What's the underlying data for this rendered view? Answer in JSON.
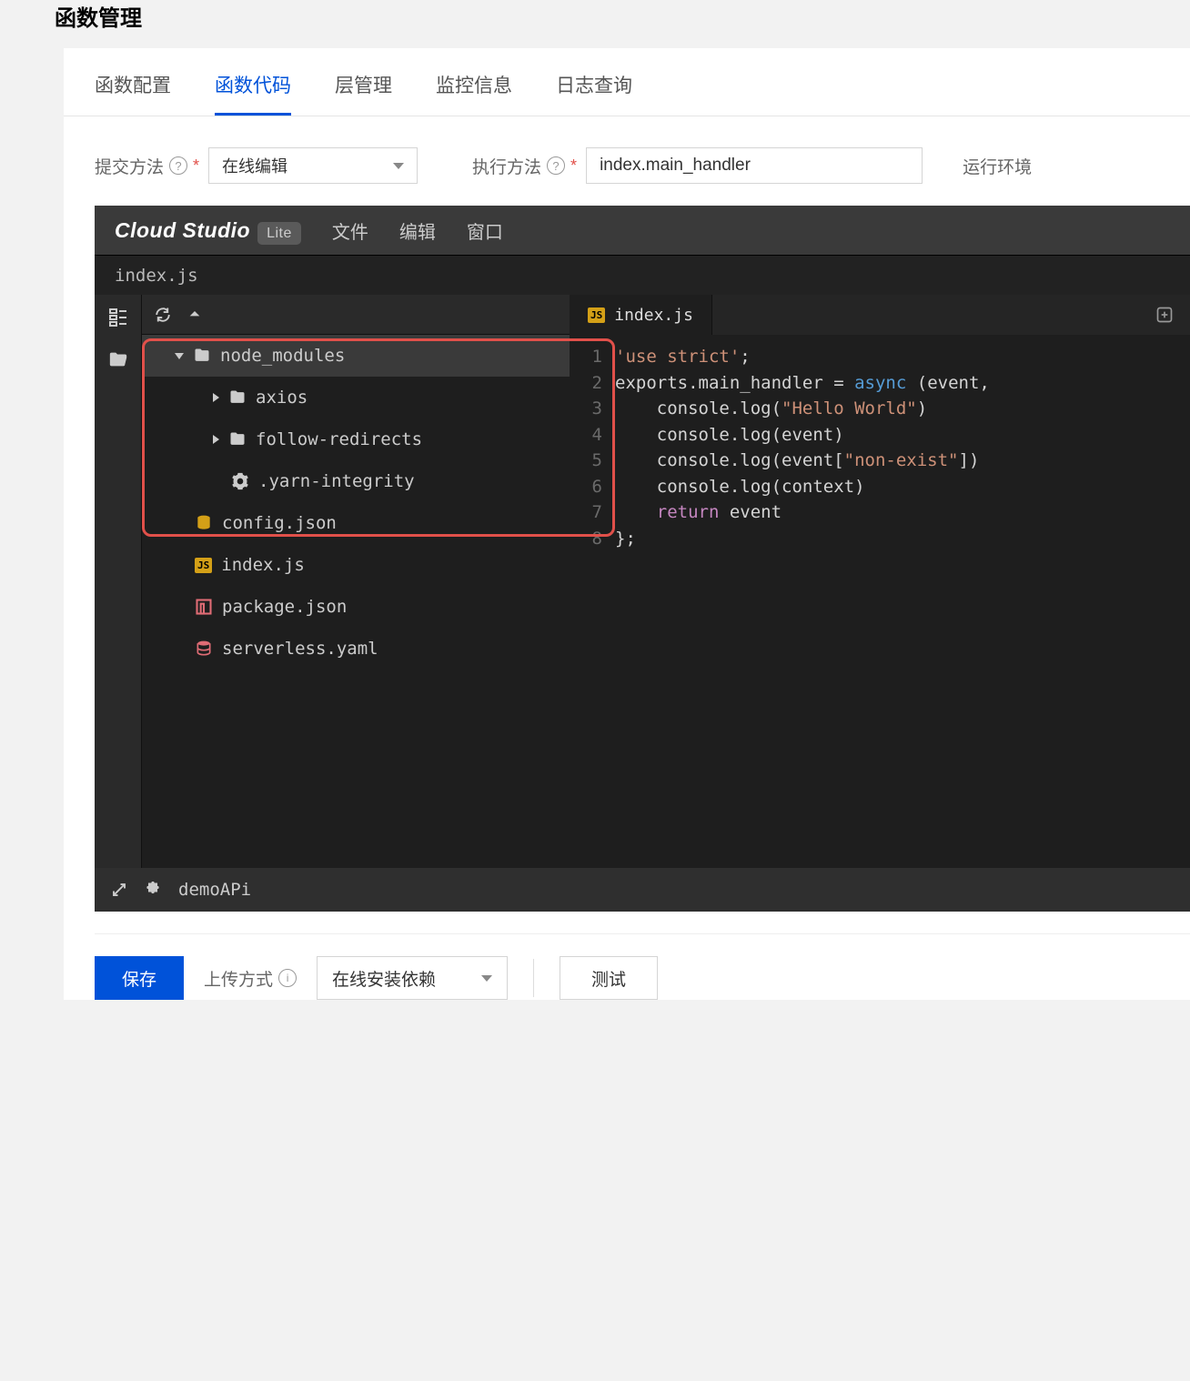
{
  "page_title": "函数管理",
  "tabs": {
    "config": "函数配置",
    "code": "函数代码",
    "layer": "层管理",
    "monitor": "监控信息",
    "log": "日志查询"
  },
  "form": {
    "submit_label": "提交方法",
    "submit_value": "在线编辑",
    "exec_label": "执行方法",
    "exec_value": "index.main_handler",
    "runtime_label": "运行环境"
  },
  "ide": {
    "brand": "Cloud Studio",
    "lite": "Lite",
    "menu": {
      "file": "文件",
      "edit": "编辑",
      "window": "窗口"
    },
    "breadcrumb": "index.js",
    "tree": {
      "node_modules": "node_modules",
      "axios": "axios",
      "follow_redirects": "follow-redirects",
      "yarn_integrity": ".yarn-integrity",
      "config_json": "config.json",
      "index_js": "index.js",
      "package_json": "package.json",
      "serverless_yaml": "serverless.yaml"
    },
    "open_tab": "index.js",
    "status_project": "demoAPi",
    "code_lines": [
      "'use strict';",
      "exports.main_handler = async (event,",
      "    console.log(\"Hello World\")",
      "    console.log(event)",
      "    console.log(event[\"non-exist\"])",
      "    console.log(context)",
      "    return event",
      "};"
    ]
  },
  "bottom": {
    "save": "保存",
    "upload_method": "上传方式",
    "install_deps": "在线安装依赖",
    "test": "测试"
  }
}
